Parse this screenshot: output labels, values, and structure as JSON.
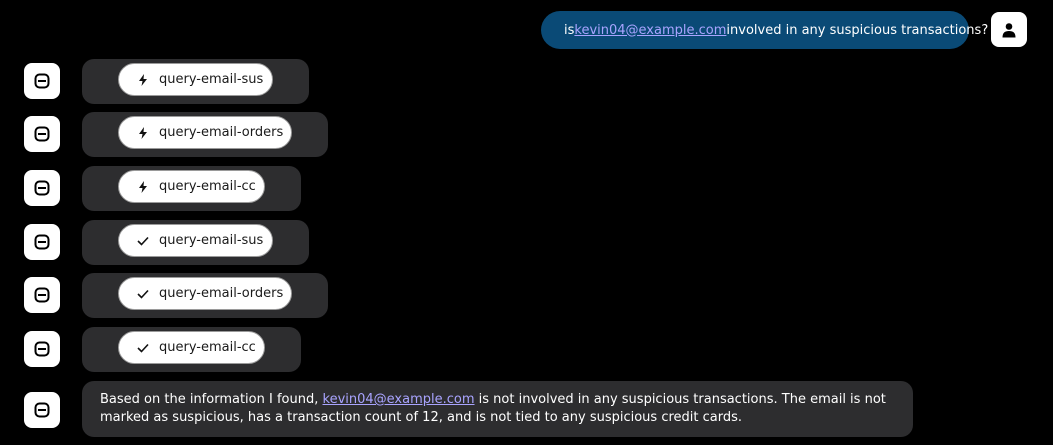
{
  "user_message": {
    "prefix": "is ",
    "email": "kevin04@example.com",
    "suffix": " involved in any suspicious transactions?"
  },
  "icons": {
    "user_avatar": "user-icon",
    "bot_avatar": "robot-icon",
    "running": "bolt-icon",
    "done": "check-icon"
  },
  "tool_calls": [
    {
      "name": "query-email-sus",
      "status": "running"
    },
    {
      "name": "query-email-orders",
      "status": "running"
    },
    {
      "name": "query-email-cc",
      "status": "running"
    },
    {
      "name": "query-email-sus",
      "status": "done"
    },
    {
      "name": "query-email-orders",
      "status": "done"
    },
    {
      "name": "query-email-cc",
      "status": "done"
    }
  ],
  "answer": {
    "prefix": "Based on the information I found, ",
    "email": "kevin04@example.com",
    "suffix": " is not involved in any suspicious transactions. The email is not marked as suspicious, has a transaction count of 12, and is not tied to any suspicious credit cards."
  },
  "colors": {
    "background": "#000000",
    "user_bubble": "#0a4a76",
    "card": "#2d2d2f",
    "link": "#a9a4ff"
  }
}
